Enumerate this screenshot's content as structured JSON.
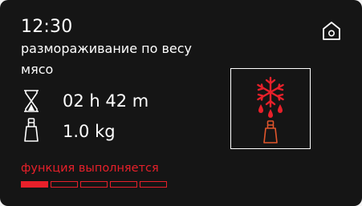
{
  "header": {
    "time": "12:30",
    "program": "размораживание по весу",
    "food": "мясо",
    "home_icon": "home-icon"
  },
  "details": {
    "duration": "02 h 42 m",
    "duration_icon": "hourglass-icon",
    "weight": "1.0 kg",
    "weight_icon": "weight-icon"
  },
  "mode": {
    "icon": "defrost-by-weight-icon"
  },
  "status": {
    "text": "функция выполняется",
    "progress_segments": 5,
    "progress_filled": 1
  },
  "colors": {
    "background": "#151515",
    "text": "#ffffff",
    "accent": "#e8202a",
    "weight_icon_accent": "#e0562c"
  }
}
